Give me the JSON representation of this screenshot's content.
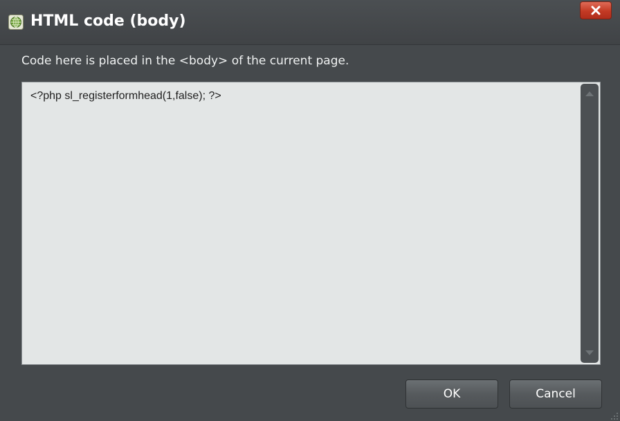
{
  "window": {
    "title": "HTML code (body)",
    "app_icon": "globe-grid-icon",
    "close_icon": "close-icon"
  },
  "instruction": "Code here is placed in the <body> of the current page.",
  "code_editor": {
    "value": "<?php sl_registerformhead(1,false); ?>"
  },
  "buttons": {
    "ok_label": "OK",
    "cancel_label": "Cancel"
  },
  "colors": {
    "dialog_bg": "#45494c",
    "editor_bg": "#e3e6e6",
    "close_red": "#c33a24",
    "text_light": "#f0f2f2"
  }
}
